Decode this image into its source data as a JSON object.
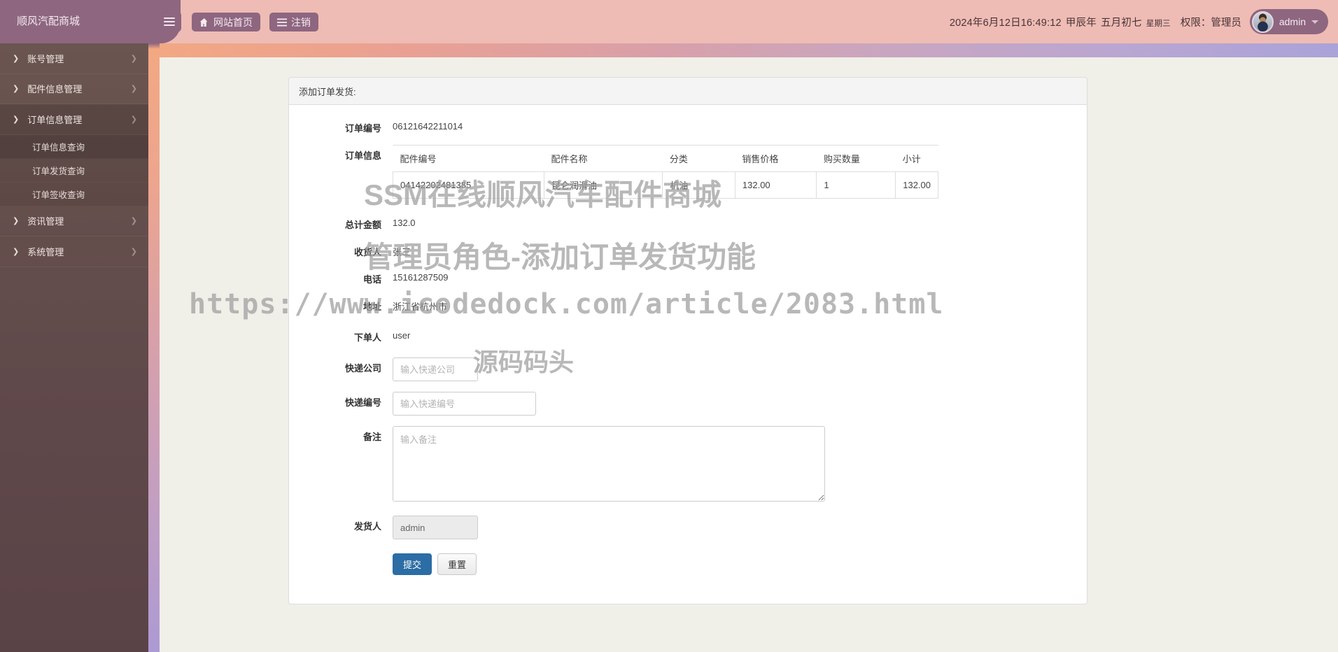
{
  "topbar": {
    "brand": "顺风汽配商城",
    "home_button": "网站首页",
    "logout_button": "注销",
    "datetime": "2024年6月12日16:49:12",
    "ganzhi_year": "甲辰年",
    "lunar_date": "五月初七",
    "weekday": "星期三",
    "permission_label": "权限：",
    "permission_value": "管理员",
    "user_name": "admin"
  },
  "sidebar": {
    "items": [
      {
        "label": "账号管理",
        "expanded": false
      },
      {
        "label": "配件信息管理",
        "expanded": false
      },
      {
        "label": "订单信息管理",
        "expanded": true
      }
    ],
    "order_sub_items": [
      {
        "label": "订单信息查询",
        "active": true
      },
      {
        "label": "订单发货查询",
        "active": false
      },
      {
        "label": "订单签收查询",
        "active": false
      }
    ],
    "tail_items": [
      {
        "label": "资讯管理",
        "expanded": false
      },
      {
        "label": "系统管理",
        "expanded": false
      }
    ]
  },
  "panel": {
    "title": "添加订单发货:",
    "fields": {
      "order_no_label": "订单编号",
      "order_no_value": "06121642211014",
      "order_info_label": "订单信息",
      "total_label": "总计金额",
      "total_value": "132.0",
      "consignee_label": "收货人",
      "consignee_value": "张三",
      "phone_label": "电话",
      "phone_value": "15161287509",
      "address_label": "地址",
      "address_value": "浙江省杭州市",
      "orderer_label": "下单人",
      "orderer_value": "user",
      "express_company_label": "快递公司",
      "express_company_placeholder": "输入快递公司",
      "express_company_value": "",
      "express_no_label": "快递编号",
      "express_no_placeholder": "输入快递编号",
      "express_no_value": "",
      "remark_label": "备注",
      "remark_placeholder": "输入备注",
      "remark_value": "",
      "shipper_label": "发货人",
      "shipper_value": "admin"
    },
    "table": {
      "headers": [
        "配件编号",
        "配件名称",
        "分类",
        "销售价格",
        "购买数量",
        "小计"
      ],
      "rows": [
        [
          "04142202481385",
          "昆仑润滑油",
          "机油",
          "132.00",
          "1",
          "132.00"
        ]
      ]
    },
    "buttons": {
      "submit": "提交",
      "reset": "重置"
    }
  },
  "watermarks": {
    "line1": "SSM在线顺风汽车配件商城",
    "line2": "管理员角色-添加订单发货功能",
    "line3": "https://www.icodedock.com/article/2083.html",
    "line4": "源码码头"
  },
  "colors": {
    "brand_purple": "#8e6680",
    "topbar_pink": "#eebcb4",
    "sidebar_brown": "#60494a",
    "primary_blue": "#2b6da4",
    "content_bg": "#f0efe8"
  }
}
